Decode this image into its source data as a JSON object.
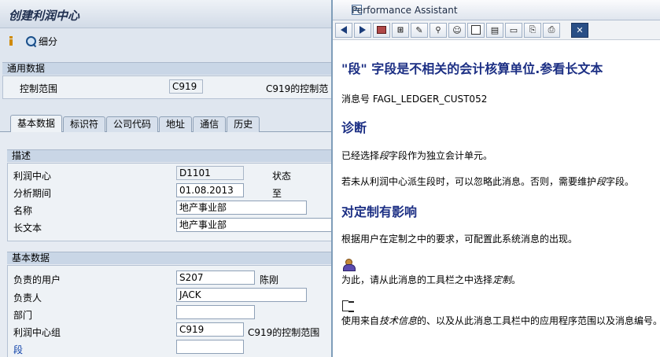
{
  "sap": {
    "title": "创建利润中心",
    "toolbar": {
      "detail_label": "细分"
    },
    "general_section": {
      "header": "通用数据",
      "controlling_area_label": "控制范围",
      "controlling_area_value": "C919",
      "controlling_area_desc": "C919的控制范"
    },
    "tabs": [
      {
        "label": "基本数据",
        "active": true
      },
      {
        "label": "标识符"
      },
      {
        "label": "公司代码"
      },
      {
        "label": "地址"
      },
      {
        "label": "通信"
      },
      {
        "label": "历史"
      }
    ],
    "description_section": {
      "header": "描述",
      "profit_center_label": "利润中心",
      "profit_center_value": "D1101",
      "status_label": "状态",
      "period_label": "分析期间",
      "period_value": "01.08.2013",
      "to_label": "至",
      "name_label": "名称",
      "name_value": "地产事业部",
      "long_text_label": "长文本",
      "long_text_value": "地产事业部"
    },
    "basic_section": {
      "header": "基本数据",
      "responsible_user_label": "负责的用户",
      "responsible_user_value": "S207",
      "responsible_user_name": "陈刚",
      "person_label": "负责人",
      "person_value": "JACK",
      "department_label": "部门",
      "department_value": "",
      "group_label": "利润中心组",
      "group_value": "C919",
      "group_desc": "C919的控制范围",
      "segment_label": "段",
      "segment_value": ""
    }
  },
  "performance_assistant": {
    "window_title": "Performance Assistant",
    "heading": "\"段\" 字段是不相关的会计核算单位.参看长文本",
    "message_no": "消息号 FAGL_LEDGER_CUST052",
    "diagnosis_heading": "诊断",
    "diagnosis_text_1": "已经选择",
    "diagnosis_text_em": "段",
    "diagnosis_text_2": "字段作为独立会计单元。",
    "diagnosis_text2_1": "若未从利润中心派生段时，可以忽略此消息。否则，需要维护",
    "diagnosis_text2_em": "段",
    "diagnosis_text2_2": "字段。",
    "impact_heading": "对定制有影响",
    "impact_text": "根据用户在定制之中的要求，可配置此系统消息的出现。",
    "procedure_text_1": "为此，请从此消息的工具栏之中选择",
    "procedure_text_em": "定制",
    "procedure_text_2": "。",
    "tech_text_1": "使用来自",
    "tech_text_em": "技术信息",
    "tech_text_2": "的、以及从此消息工具栏中的应用程序范围以及消息编号。"
  }
}
